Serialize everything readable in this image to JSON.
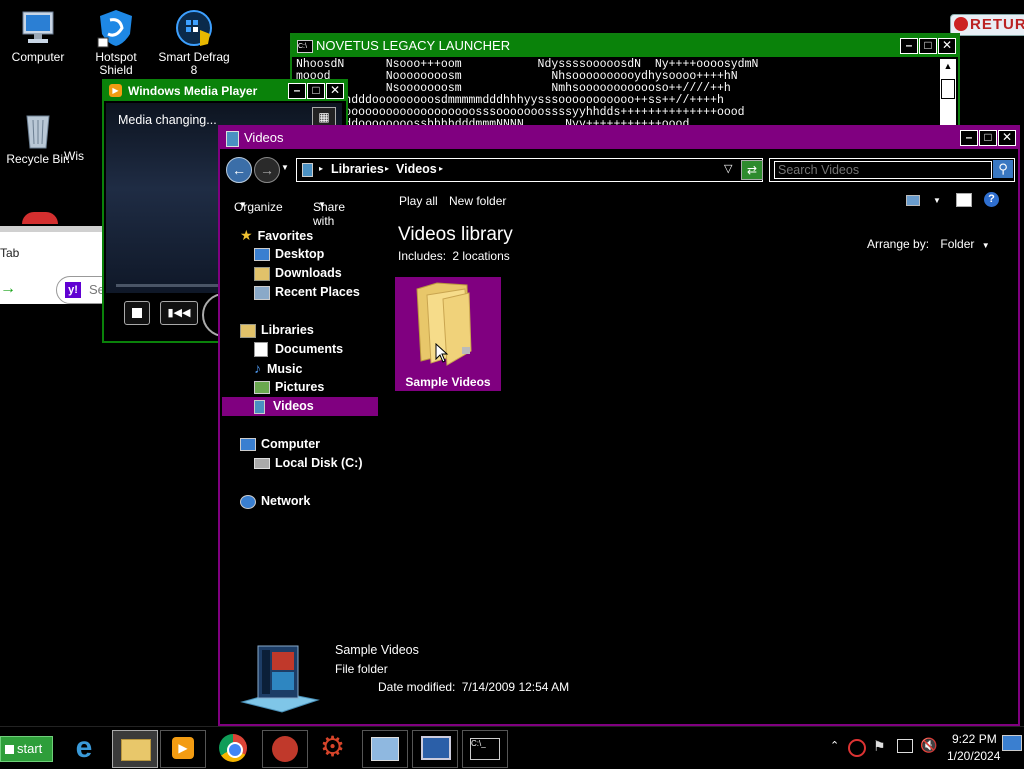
{
  "desktop": {
    "icons": [
      {
        "label": "Computer"
      },
      {
        "label": "Hotspot Shield"
      },
      {
        "label": "Smart Defrag 8"
      },
      {
        "label": "Recycle Bin"
      },
      {
        "label": "Wis"
      }
    ],
    "return_banner": "RETUR"
  },
  "browser_fragment": {
    "tab_text": "Tab",
    "search_text": "Se"
  },
  "novetus": {
    "title": "NOVETUS LEGACY LAUNCHER",
    "lines": [
      "NhoosdN      Nsooo+++oom           NdyssssooooosdN  Ny++++oooosydmN",
      "moood        Noooooooosm             Nhsoooooooooydhysoooo++++hN",
      "mN           Nsooooooosm             Nmhsoooooooooooso++////++h",
      "    syhhdddooooooooosdmmmmmdddhhhyysssooooooooooo++ss++//++++h",
      "    yssooooooooooooooooooosssooooooossssyyhhdds++++++++++++++oood",
      "  NNmmmddoooooooosshhhhdddmmmNNNN      Nyy+++++++++++oood"
    ]
  },
  "wmp": {
    "title": "Windows Media Player",
    "status": "Media changing..."
  },
  "explorer": {
    "title": "Videos",
    "breadcrumb": [
      "Libraries",
      "Videos"
    ],
    "search_placeholder": "Search Videos",
    "toolbar": {
      "organize": "Organize",
      "share_with": "Share with",
      "play_all": "Play all",
      "new_folder": "New folder"
    },
    "nav": {
      "favorites": "Favorites",
      "desktop": "Desktop",
      "downloads": "Downloads",
      "recent": "Recent Places",
      "libraries": "Libraries",
      "documents": "Documents",
      "music": "Music",
      "pictures": "Pictures",
      "videos": "Videos",
      "computer": "Computer",
      "local_disk": "Local Disk (C:)",
      "network": "Network"
    },
    "library_title": "Videos library",
    "includes_label": "Includes:",
    "includes_link": "2 locations",
    "arrange_label": "Arrange by:",
    "arrange_value": "Folder",
    "folder_item": "Sample Videos",
    "details": {
      "name": "Sample Videos",
      "type": "File folder",
      "modified_label": "Date modified:",
      "modified_value": "7/14/2009 12:54 AM"
    }
  },
  "taskbar": {
    "start_label": "start",
    "time": "9:22 PM",
    "date": "1/20/2024"
  }
}
